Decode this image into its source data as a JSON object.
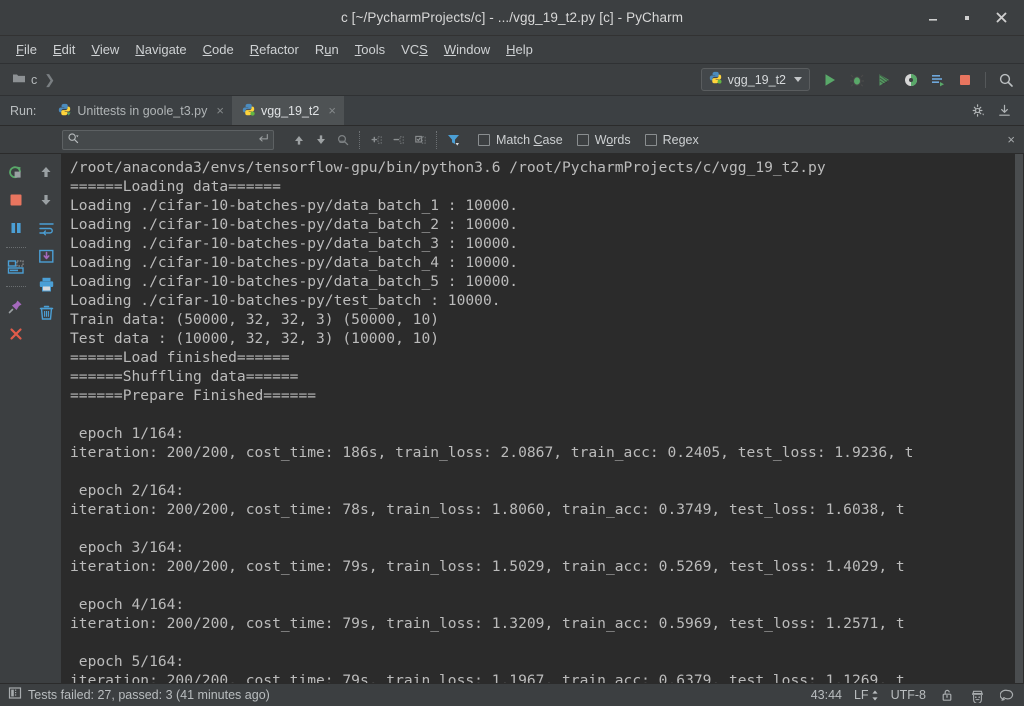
{
  "window": {
    "title": "c [~/PycharmProjects/c] - .../vgg_19_t2.py [c] - PyCharm",
    "minimize_label": "minimize",
    "maximize_label": "maximize",
    "close_label": "close"
  },
  "menubar": {
    "items": [
      {
        "label": "File",
        "mnemonic": "F"
      },
      {
        "label": "Edit",
        "mnemonic": "E"
      },
      {
        "label": "View",
        "mnemonic": "V"
      },
      {
        "label": "Navigate",
        "mnemonic": "N"
      },
      {
        "label": "Code",
        "mnemonic": "C"
      },
      {
        "label": "Refactor",
        "mnemonic": "R"
      },
      {
        "label": "Run",
        "mnemonic": "u"
      },
      {
        "label": "Tools",
        "mnemonic": "T"
      },
      {
        "label": "VCS",
        "mnemonic": "S"
      },
      {
        "label": "Window",
        "mnemonic": "W"
      },
      {
        "label": "Help",
        "mnemonic": "H"
      }
    ]
  },
  "toolbar": {
    "breadcrumb": "c",
    "run_config": "vgg_19_t2",
    "icons": [
      "run-icon",
      "debug-icon",
      "coverage-icon",
      "profile-icon",
      "run-with-console-icon",
      "stop-icon",
      "search-everywhere-icon"
    ]
  },
  "run_panel": {
    "label": "Run:",
    "tabs": [
      {
        "label": "Unittests in goole_t3.py",
        "active": false
      },
      {
        "label": "vgg_19_t2",
        "active": true
      }
    ],
    "settings_icon": "gear-icon",
    "hide_icon": "hide-panel-icon"
  },
  "search": {
    "value": "",
    "placeholder": "",
    "match_case": {
      "label": "Match Case",
      "mnemonic": "C",
      "checked": false
    },
    "words": {
      "label": "Words",
      "mnemonic": "o",
      "checked": false
    },
    "regex": {
      "label": "Regex",
      "mnemonic": "g",
      "checked": false
    },
    "close_label": "×"
  },
  "gutter": {
    "column1": [
      "rerun-icon",
      "stop-icon",
      "pause-icon",
      "console-view-icon",
      "pin-icon",
      "close-icon"
    ],
    "column2": [
      "up-arrow-icon",
      "down-arrow-icon",
      "soft-wrap-icon",
      "scroll-to-end-icon",
      "print-icon",
      "trash-icon"
    ]
  },
  "console": {
    "lines": [
      "/root/anaconda3/envs/tensorflow-gpu/bin/python3.6 /root/PycharmProjects/c/vgg_19_t2.py",
      "======Loading data======",
      "Loading ./cifar-10-batches-py/data_batch_1 : 10000.",
      "Loading ./cifar-10-batches-py/data_batch_2 : 10000.",
      "Loading ./cifar-10-batches-py/data_batch_3 : 10000.",
      "Loading ./cifar-10-batches-py/data_batch_4 : 10000.",
      "Loading ./cifar-10-batches-py/data_batch_5 : 10000.",
      "Loading ./cifar-10-batches-py/test_batch : 10000.",
      "Train data: (50000, 32, 32, 3) (50000, 10)",
      "Test data : (10000, 32, 32, 3) (10000, 10)",
      "======Load finished======",
      "======Shuffling data======",
      "======Prepare Finished======",
      "",
      " epoch 1/164:",
      "iteration: 200/200, cost_time: 186s, train_loss: 2.0867, train_acc: 0.2405, test_loss: 1.9236, t",
      "",
      " epoch 2/164:",
      "iteration: 200/200, cost_time: 78s, train_loss: 1.8060, train_acc: 0.3749, test_loss: 1.6038, t",
      "",
      " epoch 3/164:",
      "iteration: 200/200, cost_time: 79s, train_loss: 1.5029, train_acc: 0.5269, test_loss: 1.4029, t",
      "",
      " epoch 4/164:",
      "iteration: 200/200, cost_time: 79s, train_loss: 1.3209, train_acc: 0.5969, test_loss: 1.2571, t",
      "",
      " epoch 5/164:",
      "iteration: 200/200, cost_time: 79s, train_loss: 1.1967, train_acc: 0.6379, test_loss: 1.1269, t"
    ]
  },
  "statusbar": {
    "test_status": "Tests failed: 27, passed: 3 (41 minutes ago)",
    "caret_position": "43:44",
    "line_separator": "LF",
    "encoding": "UTF-8",
    "lock_icon": "unlocked-icon",
    "inspector_icon": "hector-inspector-icon",
    "events_icon": "event-log-icon"
  },
  "colors": {
    "accent_green": "#5aa83f",
    "accent_red": "#e8755f",
    "accent_blue": "#4b9fd5",
    "panel_bg": "#3c3f41",
    "console_bg": "#2b2b2b",
    "console_fg": "#bbbbbb"
  }
}
